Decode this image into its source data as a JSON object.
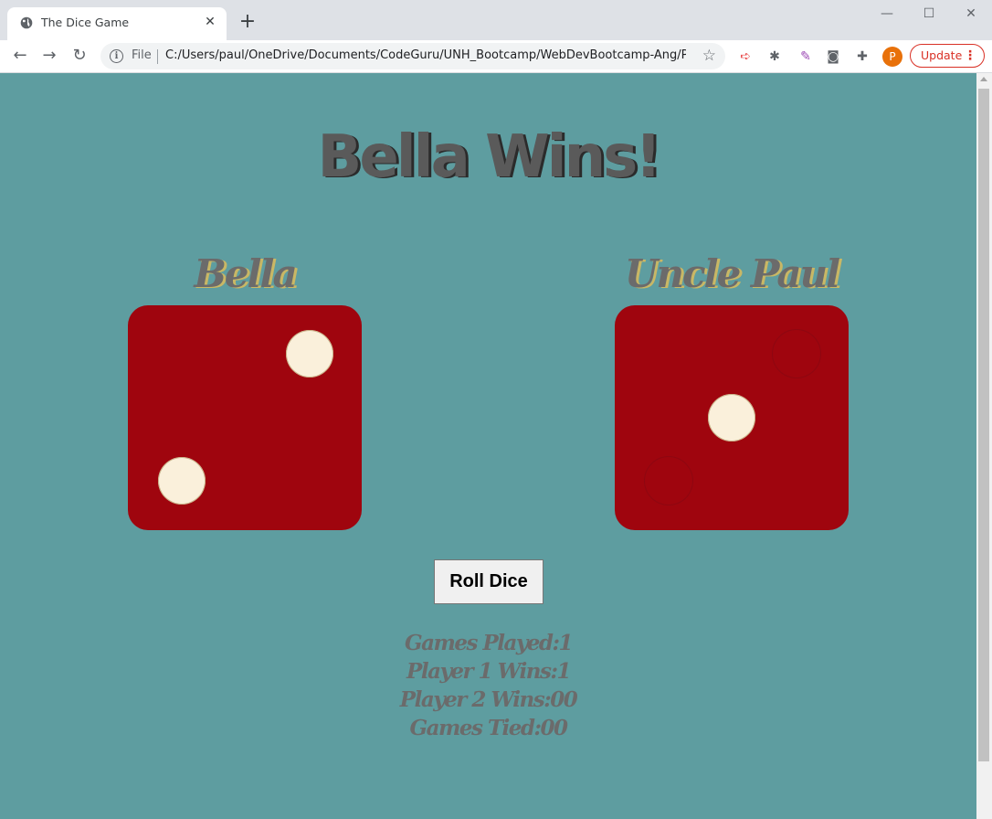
{
  "browser": {
    "tab_title": "The Dice Game",
    "new_tab": "+",
    "window_controls": {
      "minimize": "—",
      "maximize": "☐",
      "close": "✕"
    },
    "omnibox": {
      "scheme_label": "File",
      "url": "C:/Users/paul/OneDrive/Documents/CodeGuru/UNH_Bootcamp/WebDevBootcamp-Ang/P..."
    },
    "profile_initial": "P",
    "update_label": "Update"
  },
  "game": {
    "headline": "Bella Wins!",
    "players": [
      {
        "name": "Bella",
        "die_value": 2
      },
      {
        "name": "Uncle Paul",
        "die_value": 1
      }
    ],
    "roll_button": "Roll Dice",
    "stats": [
      "Games Played:1",
      "Player 1 Wins:1",
      "Player 2 Wins:00",
      "Games Tied:00"
    ]
  },
  "colors": {
    "page_background": "#5e9da0",
    "die_face": "#9f050e",
    "pip": "#faf0db",
    "text": "#5a5a5a"
  }
}
